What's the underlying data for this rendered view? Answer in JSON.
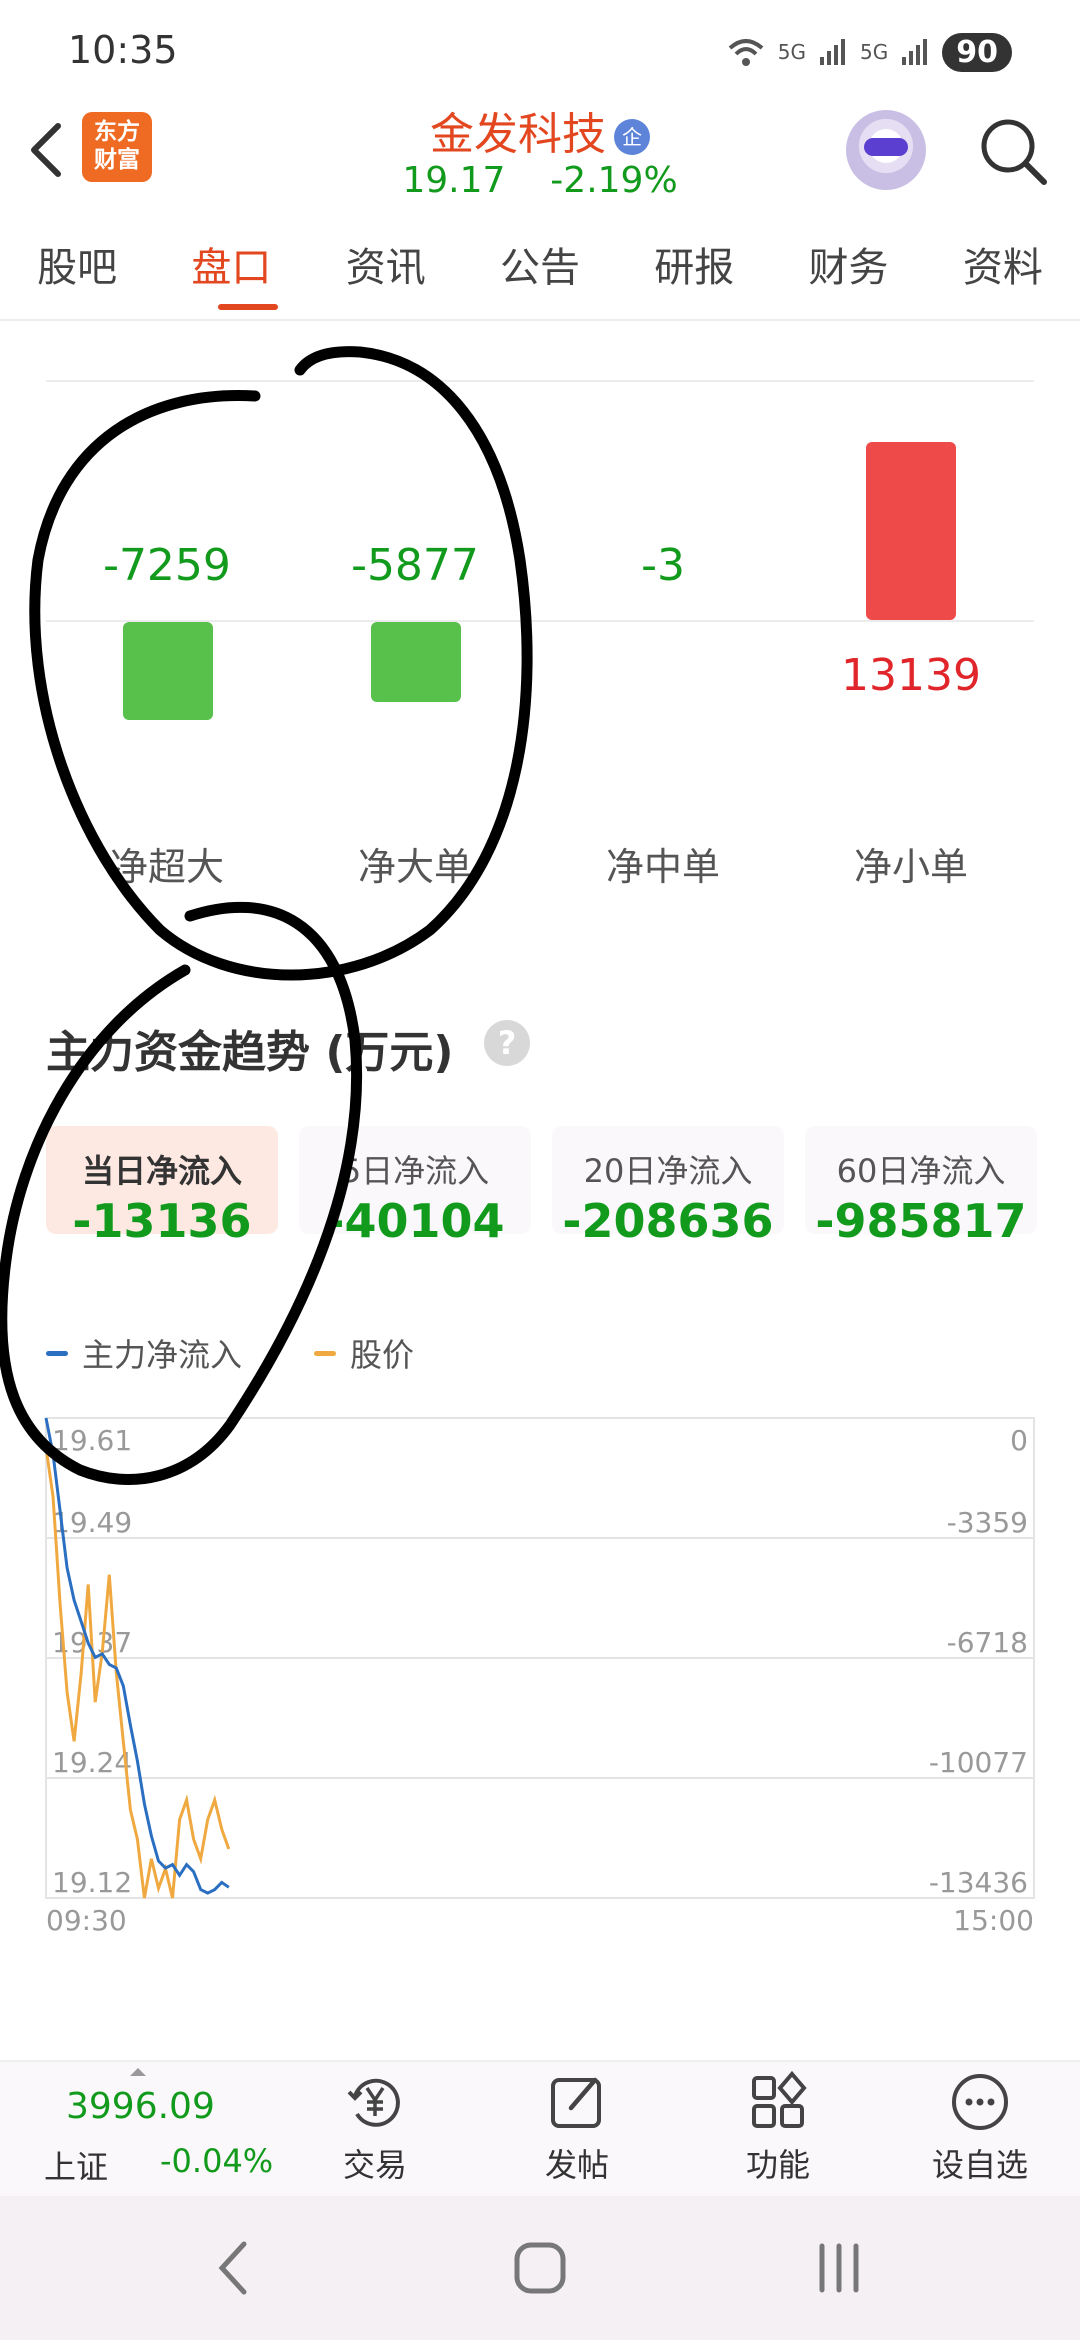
{
  "status_bar": {
    "time": "10:35",
    "battery": "90",
    "signal_label_1": "5G",
    "signal_label_2": "5G"
  },
  "header": {
    "app_logo_text": "东方\n财富",
    "stock_name": "金发科技",
    "badge": "企",
    "price": "19.17",
    "change_pct": "-2.19%",
    "icons": [
      "back-icon",
      "robot-avatar-icon",
      "search-icon"
    ]
  },
  "tabs": [
    {
      "label": "股吧"
    },
    {
      "label": "盘口"
    },
    {
      "label": "资讯"
    },
    {
      "label": "公告"
    },
    {
      "label": "研报"
    },
    {
      "label": "财务"
    },
    {
      "label": "资料"
    }
  ],
  "active_tab_index": 1,
  "net_flow_bars": [
    {
      "label": "净超大",
      "value": "-7259",
      "color": "#57c14b"
    },
    {
      "label": "净大单",
      "value": "-5877",
      "color": "#57c14b"
    },
    {
      "label": "净中单",
      "value": "-3",
      "color": "#57c14b"
    },
    {
      "label": "净小单",
      "value": "13139",
      "color": "#ef4a4a"
    }
  ],
  "trend": {
    "title": "主力资金趋势 (万元)",
    "help_icon": "?",
    "cards": [
      {
        "label": "当日净流入",
        "value": "-13136",
        "active": true
      },
      {
        "label": "5日净流入",
        "value": "-40104",
        "active": false
      },
      {
        "label": "20日净流入",
        "value": "-208636",
        "active": false
      },
      {
        "label": "60日净流入",
        "value": "-985817",
        "active": false
      }
    ],
    "legend": [
      {
        "name": "主力净流入",
        "color": "#2a6fc1"
      },
      {
        "name": "股价",
        "color": "#f0a940"
      }
    ]
  },
  "chart_data": {
    "type": "line",
    "x_start_label": "09:30",
    "x_end_label": "15:00",
    "left_axis_ticks": [
      "19.61",
      "19.49",
      "19.37",
      "19.24",
      "19.12"
    ],
    "right_axis_ticks": [
      "0",
      "-3359",
      "-6718",
      "-10077",
      "-13436"
    ],
    "price_range": [
      19.12,
      19.61
    ],
    "flow_range": [
      -13436,
      0
    ],
    "series": [
      {
        "name": "主力净流入",
        "color": "#2a6fc1",
        "values": [
          0,
          -1000,
          -2600,
          -4200,
          -5100,
          -5700,
          -6300,
          -6700,
          -6600,
          -6900,
          -7000,
          -7500,
          -8600,
          -9600,
          -10800,
          -11700,
          -12400,
          -12600,
          -12500,
          -12800,
          -12500,
          -12700,
          -13200,
          -13300,
          -13200,
          -13000,
          -13136
        ]
      },
      {
        "name": "股价",
        "color": "#f0a940",
        "values": [
          19.58,
          19.53,
          19.42,
          19.33,
          19.28,
          19.35,
          19.44,
          19.32,
          19.37,
          19.45,
          19.35,
          19.28,
          19.21,
          19.18,
          19.12,
          19.16,
          19.13,
          19.15,
          19.12,
          19.2,
          19.22,
          19.18,
          19.16,
          19.2,
          19.22,
          19.19,
          19.17
        ]
      }
    ]
  },
  "bottom_bar": {
    "index_value": "3996.09",
    "index_name": "上证",
    "index_change": "-0.04%",
    "nav": [
      {
        "label": "交易",
        "icon": "trade-yen-icon"
      },
      {
        "label": "发帖",
        "icon": "edit-post-icon"
      },
      {
        "label": "功能",
        "icon": "grid-function-icon"
      },
      {
        "label": "设自选",
        "icon": "more-dots-icon"
      }
    ]
  },
  "system_nav": {
    "icons": [
      "back-nav-icon",
      "home-nav-icon",
      "recent-apps-icon"
    ]
  }
}
